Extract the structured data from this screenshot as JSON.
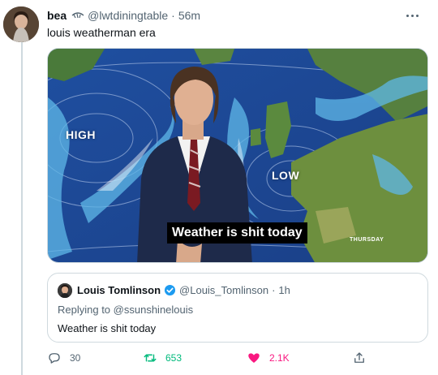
{
  "tweet": {
    "display_name": "bea",
    "handle": "@lwtdiningtable",
    "separator": "·",
    "timestamp": "56m",
    "text": "louis weatherman era",
    "more_icon": "more-horizontal-icon"
  },
  "media": {
    "caption": "Weather is shit today",
    "high_label": "HIGH",
    "low_label": "LOW",
    "day_label": "THURSDAY"
  },
  "quote": {
    "display_name": "Louis Tomlinson",
    "verified_icon": "verified-badge-icon",
    "handle": "@Louis_Tomlinson",
    "separator": "·",
    "timestamp": "1h",
    "replying_to_prefix": "Replying to",
    "replying_to_mention": "@ssunshinelouis",
    "text": "Weather is shit today"
  },
  "actions": {
    "reply_count": "30",
    "retweet_count": "653",
    "like_count": "2.1K",
    "colors": {
      "reply": "#536471",
      "retweet": "#00ba7c",
      "like": "#f91880",
      "share": "#536471"
    }
  },
  "colors": {
    "text": "#0f1419",
    "secondary": "#536471",
    "border": "#cfd9de",
    "verified": "#1d9bf0"
  }
}
